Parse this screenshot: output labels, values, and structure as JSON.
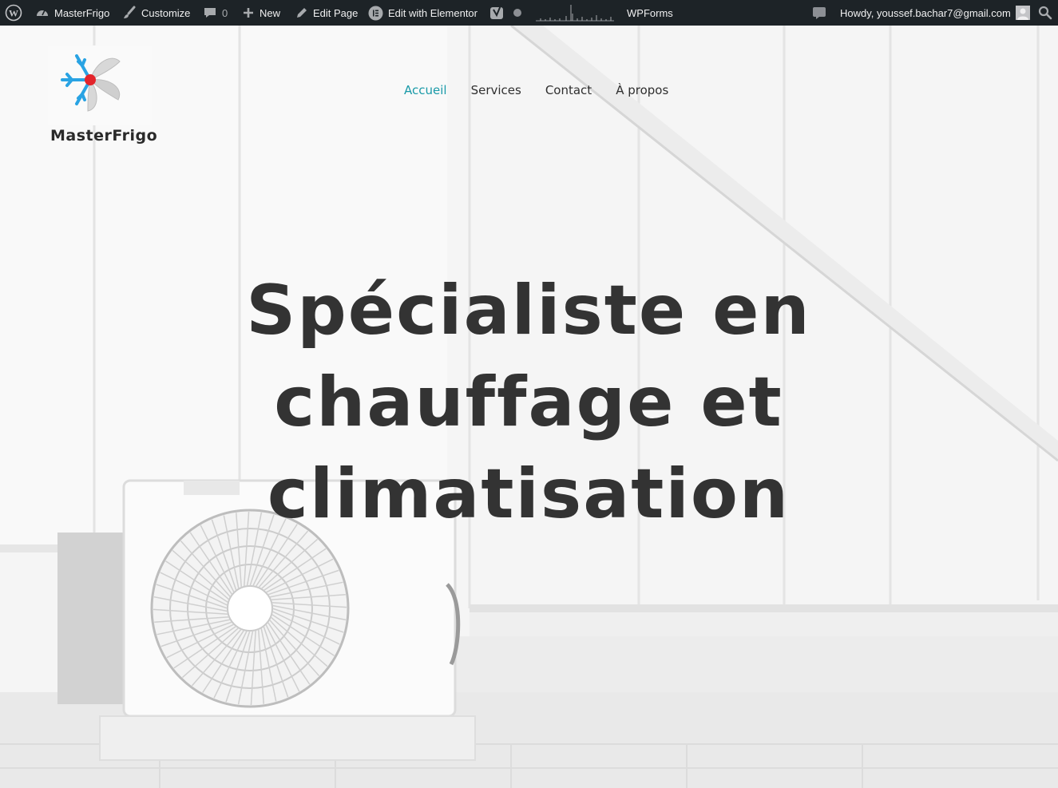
{
  "admin_bar": {
    "site_name": "MasterFrigo",
    "customize": "Customize",
    "comments_count": "0",
    "new": "New",
    "edit_page": "Edit Page",
    "edit_elementor": "Edit with Elementor",
    "wpforms": "WPForms",
    "greeting": "Howdy, youssef.bachar7@gmail.com"
  },
  "site": {
    "brand": "MasterFrigo",
    "nav": [
      "Accueil",
      "Services",
      "Contact",
      "À propos"
    ],
    "active_nav": "Accueil"
  },
  "hero": {
    "headline_lines": [
      "Spécialiste en",
      "chauffage et",
      "climatisation"
    ]
  },
  "colors": {
    "admin_bar_bg": "#1d2327",
    "nav_active": "#1a9aa8",
    "headline": "#333333",
    "logo_blue": "#29a3e3",
    "logo_red": "#e3242b"
  }
}
